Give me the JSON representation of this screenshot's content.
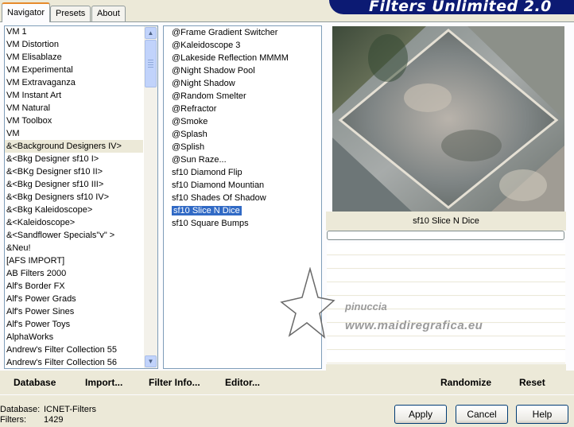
{
  "app": {
    "title": "Filters Unlimited 2.0"
  },
  "tabs": [
    {
      "label": "Navigator",
      "active": true
    },
    {
      "label": "Presets",
      "active": false
    },
    {
      "label": "About",
      "active": false
    }
  ],
  "categories": [
    "VM 1",
    "VM Distortion",
    "VM Elisablaze",
    "VM Experimental",
    "VM Extravaganza",
    "VM Instant Art",
    "VM Natural",
    "VM Toolbox",
    "VM",
    "&<Background Designers IV>",
    "&<Bkg Designer sf10 I>",
    "&<BKg Designer sf10 II>",
    "&<Bkg Designer sf10 III>",
    "&<Bkg Designers sf10 IV>",
    "&<Bkg Kaleidoscope>",
    "&<Kaleidoscope>",
    "&<Sandflower Specials\"v\" >",
    "&Neu!",
    "[AFS IMPORT]",
    "AB Filters 2000",
    "Alf's Border FX",
    "Alf's Power Grads",
    "Alf's Power Sines",
    "Alf's Power Toys",
    "AlphaWorks",
    "Andrew's Filter Collection 55",
    "Andrew's Filter Collection 56"
  ],
  "selected_category": "&<Background Designers IV>",
  "filters": [
    "@Frame Gradient Switcher",
    "@Kaleidoscope 3",
    "@Lakeside Reflection MMMM",
    "@Night Shadow Pool",
    "@Night Shadow",
    "@Random Smelter",
    "@Refractor",
    "@Smoke",
    "@Splash",
    "@Splish",
    "@Sun Raze...",
    "sf10 Diamond Flip",
    "sf10 Diamond Mountian",
    "sf10 Shades Of Shadow",
    "sf10 Slice N Dice",
    "sf10 Square Bumps"
  ],
  "selected_filter": "sf10 Slice N Dice",
  "preview": {
    "caption": "sf10 Slice N Dice"
  },
  "bottom_links": {
    "database": "Database",
    "import": "Import...",
    "filter_info": "Filter Info...",
    "editor": "Editor...",
    "randomize": "Randomize",
    "reset": "Reset"
  },
  "status": {
    "database_label": "Database:",
    "database_value": "ICNET-Filters",
    "filters_label": "Filters:",
    "filters_value": "1429"
  },
  "buttons": {
    "apply": "Apply",
    "cancel": "Cancel",
    "help": "Help"
  },
  "watermark": {
    "line1": "pinuccia",
    "line2": "www.maidiregrafica.eu"
  },
  "colors": {
    "banner": "#0c1a73",
    "selection": "#316ac5",
    "tab_accent": "#e68b2c"
  },
  "icons": {
    "scroll_up": "chevron-up-icon",
    "scroll_down": "chevron-down-icon",
    "watermark_star": "star-icon"
  }
}
